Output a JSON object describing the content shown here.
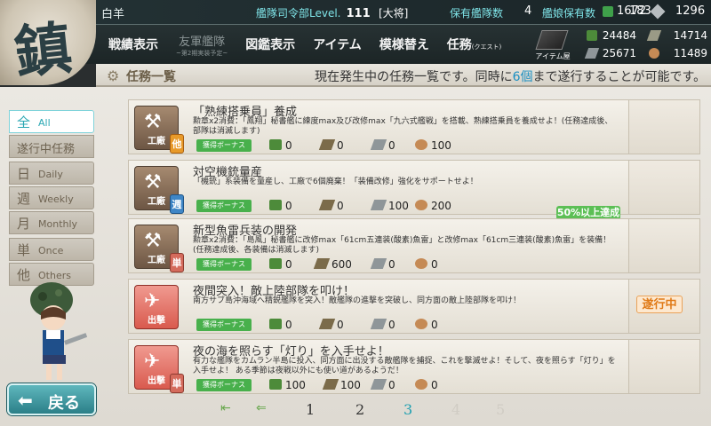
{
  "header": {
    "emblem_glyph": "鎮",
    "admiral_name": "白羊",
    "hq_label": "艦隊司令部Level.",
    "hq_level": "111",
    "rank": "[大将]",
    "ships_label": "保有艦隊数",
    "ships_count": "4",
    "girls_label": "艦娘保有数",
    "girls_count": "183",
    "bucket_count": "1672",
    "screw_count": "1296"
  },
  "menu": {
    "record": "戦績表示",
    "friend": "友軍艦隊",
    "friend_sub": "~第2期実装予定~",
    "library": "図鑑表示",
    "item": "アイテム",
    "remodel": "模様替え",
    "quest": "任務",
    "quest_sup": "(クエスト)",
    "item_shop": "アイテム屋"
  },
  "resources": {
    "fuel": "24484",
    "ammo": "14714",
    "steel": "25671",
    "bauxite": "11489"
  },
  "titlebar": {
    "title": "任務一覧",
    "notice_pre": "現在発生中の任務一覧です。同時に",
    "notice_num": "6個",
    "notice_post": "まで遂行することが可能です。"
  },
  "tabs": [
    {
      "big": "全",
      "small": "All",
      "active": true
    },
    {
      "label": "遂行中任務"
    },
    {
      "big": "日",
      "small": "Daily"
    },
    {
      "big": "週",
      "small": "Weekly"
    },
    {
      "big": "月",
      "small": "Monthly"
    },
    {
      "big": "単",
      "small": "Once"
    },
    {
      "big": "他",
      "small": "Others"
    }
  ],
  "quests": [
    {
      "category": "工廠",
      "period": "他",
      "title": "「熟練搭乗員」養成",
      "desc": "勲章x2消費：「鳳翔」秘書艦に練度max及び改修max「九六式艦戦」を搭載、熟練搭乗員を養成せよ！(任務達成後、部隊は消滅します)",
      "bonus": "獲得ボーナス",
      "fuel": "0",
      "ammo": "0",
      "steel": "0",
      "baux": "100"
    },
    {
      "category": "工廠",
      "period": "週",
      "title": "対空機銃量産",
      "desc": "「機銃」系装備を量産し、工廠で6個廃棄！「装備改修」強化をサポートせよ！",
      "bonus": "獲得ボーナス",
      "fuel": "0",
      "ammo": "0",
      "steel": "100",
      "baux": "200",
      "status": "50%以上達成"
    },
    {
      "category": "工廠",
      "period": "単",
      "title": "新型魚雷兵装の開発",
      "desc": "勲章x2消費：「島風」秘書艦に改修max「61cm五連装(酸素)魚雷」と改修max「61cm三連装(酸素)魚雷」を装備！(任務達成後、各装備は消滅します)",
      "bonus": "獲得ボーナス",
      "fuel": "0",
      "ammo": "600",
      "steel": "0",
      "baux": "0"
    },
    {
      "category": "出撃",
      "period": "",
      "title": "夜間突入！敵上陸部隊を叩け！",
      "desc": "南方サブ島沖海域へ精鋭艦隊を突入！敵艦隊の進撃を突破し、同方面の敵上陸部隊を叩け！",
      "bonus": "獲得ボーナス",
      "fuel": "0",
      "ammo": "0",
      "steel": "0",
      "baux": "0",
      "status": "遂行中"
    },
    {
      "category": "出撃",
      "period": "単",
      "title": "夜の海を照らす「灯り」を入手せよ！",
      "desc": "有力な艦隊をカムラン半島に投入、同方面に出没する敵艦隊を捕捉、これを撃滅せよ！そして、夜を照らす「灯り」を入手せよ！ ある季節は夜戦以外にも使い道があるようだ！",
      "bonus": "獲得ボーナス",
      "fuel": "100",
      "ammo": "100",
      "steel": "0",
      "baux": "0"
    }
  ],
  "pagination": {
    "first": "⇤",
    "prev": "⇐",
    "pages": [
      "1",
      "2",
      "3",
      "4",
      "5"
    ],
    "current": "3"
  },
  "back_label": "戻る",
  "colors": {
    "accent": "#1d9fb0",
    "active_status": "#e07a17",
    "progress_green": "#5cbf55"
  }
}
